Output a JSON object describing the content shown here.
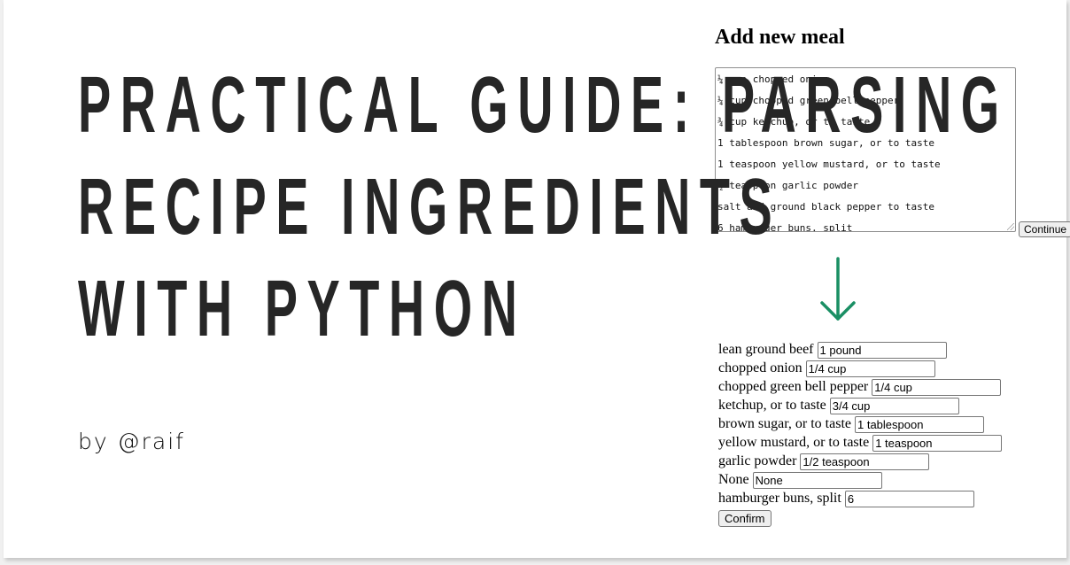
{
  "title_lines": [
    "Practical guide: parsing",
    "recipe ingredients",
    "with python"
  ],
  "byline": "by @raif",
  "form": {
    "heading": "Add new meal",
    "textarea_lines": [
      "¼ cup chopped onion",
      "¼ cup chopped green bell pepper",
      "¾ cup ketchup, or to taste",
      "1 tablespoon brown sugar, or to taste",
      "1 teaspoon yellow mustard, or to taste",
      "½ teaspoon garlic powder",
      "salt and ground black pepper to taste",
      "6 hamburger buns, split"
    ],
    "continue_label": "Continue",
    "arrow_color": "#1a8f64",
    "ingredients": [
      {
        "name": "lean ground beef",
        "quantity": "1 pound"
      },
      {
        "name": "chopped onion",
        "quantity": "1/4 cup"
      },
      {
        "name": "chopped green bell pepper",
        "quantity": "1/4 cup"
      },
      {
        "name": "ketchup, or to taste",
        "quantity": "3/4 cup"
      },
      {
        "name": "brown sugar, or to taste",
        "quantity": "1 tablespoon"
      },
      {
        "name": "yellow mustard, or to taste",
        "quantity": "1 teaspoon"
      },
      {
        "name": "garlic powder",
        "quantity": "1/2 teaspoon"
      },
      {
        "name": "None",
        "quantity": "None"
      },
      {
        "name": "hamburger buns, split",
        "quantity": "6"
      }
    ],
    "confirm_label": "Confirm"
  }
}
